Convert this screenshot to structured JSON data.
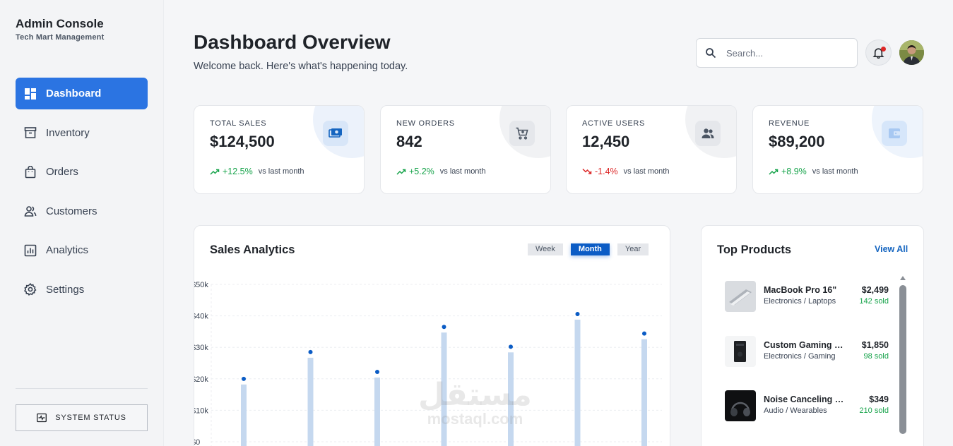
{
  "sidebar": {
    "title": "Admin Console",
    "subtitle": "Tech Mart Management",
    "items": [
      {
        "label": "Dashboard",
        "icon": "dashboard-icon",
        "active": true
      },
      {
        "label": "Inventory",
        "icon": "archive-icon"
      },
      {
        "label": "Orders",
        "icon": "shopping-bag-icon"
      },
      {
        "label": "Customers",
        "icon": "users-icon"
      },
      {
        "label": "Analytics",
        "icon": "bar-chart-icon"
      },
      {
        "label": "Settings",
        "icon": "gear-icon"
      }
    ],
    "system_status": "SYSTEM STATUS"
  },
  "header": {
    "title": "Dashboard Overview",
    "subtitle": "Welcome back. Here's what's happening today.",
    "search_placeholder": "Search..."
  },
  "stats": [
    {
      "label": "TOTAL SALES",
      "value": "$124,500",
      "change": "+12.5%",
      "direction": "up",
      "note": "vs last month",
      "icon": "money-icon",
      "accent": "#1565c0"
    },
    {
      "label": "NEW ORDERS",
      "value": "842",
      "change": "+5.2%",
      "direction": "up",
      "note": "vs last month",
      "icon": "cart-icon",
      "accent": "#4b5563"
    },
    {
      "label": "ACTIVE USERS",
      "value": "12,450",
      "change": "-1.4%",
      "direction": "down",
      "note": "vs last month",
      "icon": "users-icon",
      "accent": "#4b5563"
    },
    {
      "label": "REVENUE",
      "value": "$89,200",
      "change": "+8.9%",
      "direction": "up",
      "note": "vs last month",
      "icon": "wallet-icon",
      "accent": "#7fb0ee"
    }
  ],
  "analytics": {
    "title": "Sales Analytics",
    "ranges": [
      "Week",
      "Month",
      "Year"
    ],
    "active_range": "Month"
  },
  "chart_data": {
    "type": "bar",
    "title": "Sales Analytics",
    "y_ticks": [
      "$0",
      "$10k",
      "$20k",
      "$30k",
      "$40k",
      "$50k"
    ],
    "ylim": [
      0,
      50000
    ],
    "values": [
      18200,
      26700,
      20400,
      34700,
      28400,
      38800,
      32600
    ],
    "grid": true,
    "colors": {
      "bar": "#c5d8ef",
      "point": "#0b5cc5"
    }
  },
  "products": {
    "title": "Top Products",
    "view_all": "View All",
    "items": [
      {
        "name": "MacBook Pro 16\"",
        "category": "Electronics / Laptops",
        "price": "$2,499",
        "sold": "142 sold"
      },
      {
        "name": "Custom Gaming PC",
        "category": "Electronics / Gaming",
        "price": "$1,850",
        "sold": "98 sold"
      },
      {
        "name": "Noise Canceling Headphones",
        "category": "Audio / Wearables",
        "price": "$349",
        "sold": "210 sold"
      }
    ]
  },
  "watermark": {
    "arabic": "مستقل",
    "latin": "mostaql.com"
  }
}
